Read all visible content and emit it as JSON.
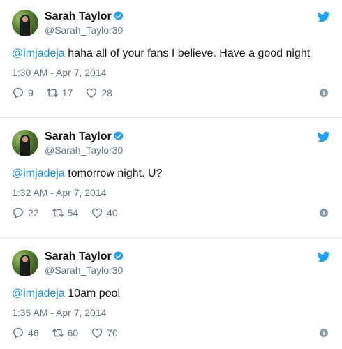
{
  "colors": {
    "brand": "#1da1f2",
    "mention": "#1b95e0",
    "secondary_text": "#657786",
    "divider": "#e1e8ed"
  },
  "icons": {
    "verified": "verified-badge-icon",
    "logo": "twitter-bird-icon",
    "reply": "reply-icon",
    "retweet": "retweet-icon",
    "like": "heart-icon",
    "info": "info-icon"
  },
  "tweets": [
    {
      "author_name": "Sarah Taylor",
      "handle": "@Sarah_Taylor30",
      "mention": "@imjadeja",
      "text": " haha all of your fans I believe. Have a good night",
      "timestamp": "1:30 AM - Apr 7, 2014",
      "replies": "9",
      "retweets": "17",
      "likes": "28"
    },
    {
      "author_name": "Sarah Taylor",
      "handle": "@Sarah_Taylor30",
      "mention": "@imjadeja",
      "text": " tomorrow night. U?",
      "timestamp": "1:32 AM - Apr 7, 2014",
      "replies": "22",
      "retweets": "54",
      "likes": "40"
    },
    {
      "author_name": "Sarah Taylor",
      "handle": "@Sarah_Taylor30",
      "mention": "@imjadeja",
      "text": " 10am pool",
      "timestamp": "1:35 AM - Apr 7, 2014",
      "replies": "46",
      "retweets": "60",
      "likes": "70"
    }
  ]
}
